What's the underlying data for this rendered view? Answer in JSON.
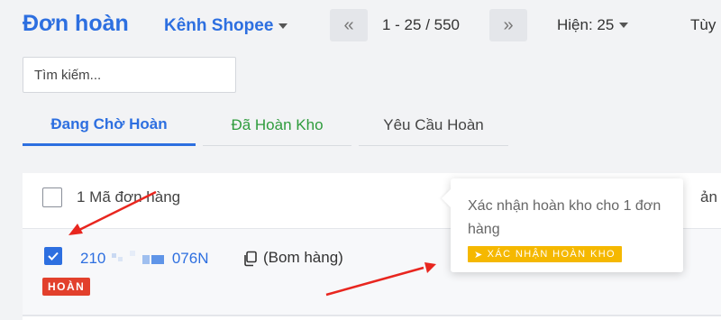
{
  "header": {
    "title": "Đơn hoàn",
    "channel": "Kênh Shopee",
    "pager": {
      "range": "1 - 25 / 550",
      "prev_icon": "«",
      "next_icon": "»"
    },
    "per_page": "Hiện: 25",
    "options_label": "Tùy"
  },
  "search": {
    "placeholder": "Tìm kiếm..."
  },
  "tabs": [
    {
      "label": "Đang Chờ Hoàn",
      "active": true
    },
    {
      "label": "Đã Hoàn Kho",
      "active": false
    },
    {
      "label": "Yêu Cầu Hoàn",
      "active": false
    }
  ],
  "table": {
    "header": {
      "selected_count": "1 Mã đơn hàng",
      "cut_column": "ản ph"
    },
    "rows": [
      {
        "checked": true,
        "code_prefix": "210",
        "code_suffix": "076N",
        "note": "(Bom hàng)",
        "status": "HOÀN"
      }
    ]
  },
  "popover": {
    "text": "Xác nhận hoàn kho cho 1 đơn hàng",
    "button_label": "XÁC NHẬN HOÀN KHO",
    "button_icon": "➤"
  },
  "colors": {
    "brand": "#2d6fe0",
    "success": "#2f9c3d",
    "danger": "#e2402c",
    "warning": "#f5b800",
    "annotation": "#e8261f"
  }
}
